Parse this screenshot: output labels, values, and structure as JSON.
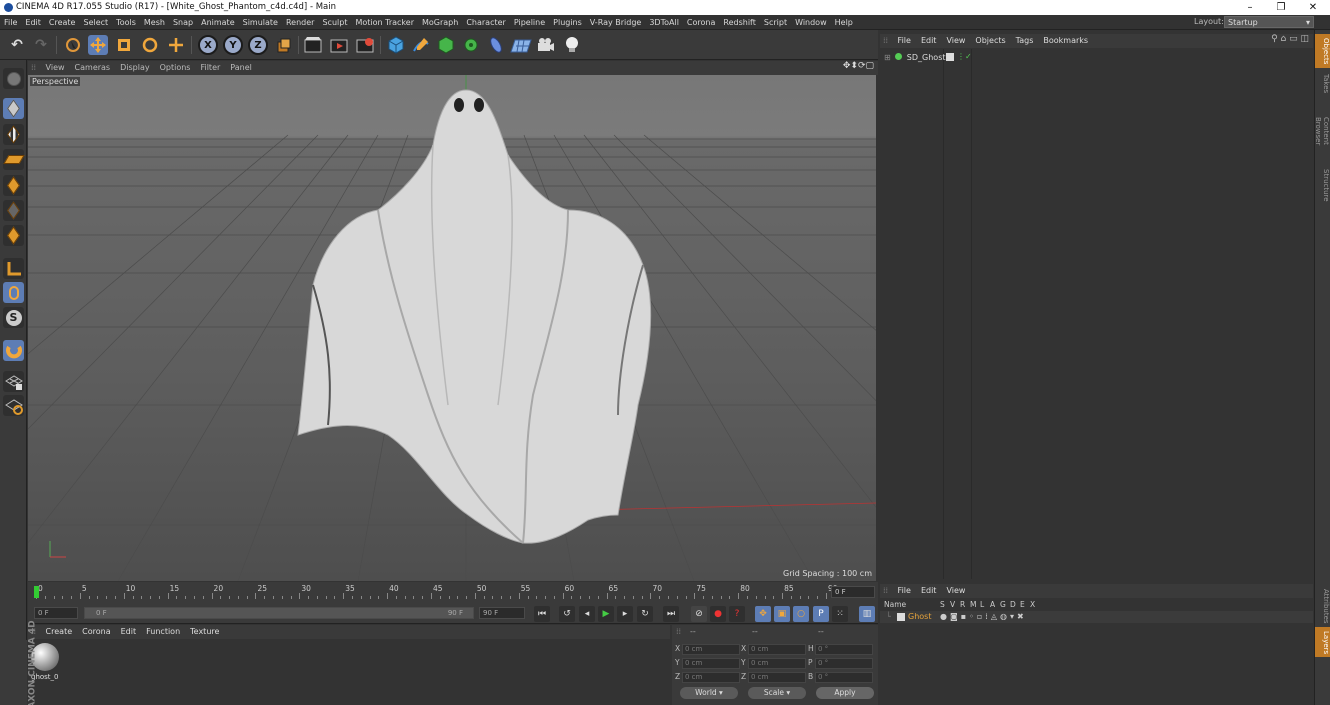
{
  "window": {
    "title": "CINEMA 4D R17.055 Studio (R17) - [White_Ghost_Phantom_c4d.c4d] - Main",
    "controls": [
      "–",
      "❐",
      "✕"
    ]
  },
  "menubar": {
    "items": [
      "File",
      "Edit",
      "Create",
      "Select",
      "Tools",
      "Mesh",
      "Snap",
      "Animate",
      "Simulate",
      "Render",
      "Sculpt",
      "Motion Tracker",
      "MoGraph",
      "Character",
      "Pipeline",
      "Plugins",
      "V-Ray Bridge",
      "3DToAll",
      "Corona",
      "Redshift",
      "Script",
      "Window",
      "Help"
    ],
    "layout_label": "Layout:",
    "layout_value": "Startup"
  },
  "toolbar": {
    "axis_x": "X",
    "axis_y": "Y",
    "axis_z": "Z"
  },
  "viewport": {
    "menu": [
      "View",
      "Cameras",
      "Display",
      "Options",
      "Filter",
      "Panel"
    ],
    "view_name": "Perspective",
    "grid_spacing": "Grid Spacing : 100 cm"
  },
  "timeline": {
    "ticks": [
      "0",
      "5",
      "10",
      "15",
      "20",
      "25",
      "30",
      "35",
      "40",
      "45",
      "50",
      "55",
      "60",
      "65",
      "70",
      "75",
      "80",
      "85",
      "90"
    ],
    "current_frame": "0 F",
    "start_field": "0 F",
    "range_start": "0 F",
    "range_end": "90 F",
    "end_field": "90 F"
  },
  "material_manager": {
    "menu": [
      "Create",
      "Corona",
      "Edit",
      "Function",
      "Texture"
    ],
    "materials": [
      {
        "name": "ghost_0"
      }
    ],
    "brand_text": "MAXON CINEMA 4D"
  },
  "coordinates": {
    "headers": [
      "--",
      "--",
      "--"
    ],
    "rows": [
      {
        "a": "X",
        "v1": "0 cm",
        "b": "X",
        "v2": "0 cm",
        "c": "H",
        "v3": "0 °"
      },
      {
        "a": "Y",
        "v1": "0 cm",
        "b": "Y",
        "v2": "0 cm",
        "c": "P",
        "v3": "0 °"
      },
      {
        "a": "Z",
        "v1": "0 cm",
        "b": "Z",
        "v2": "0 cm",
        "c": "B",
        "v3": "0 °"
      }
    ],
    "world_label": "World",
    "scale_label": "Scale",
    "apply_label": "Apply"
  },
  "object_manager": {
    "menu": [
      "File",
      "Edit",
      "View",
      "Objects",
      "Tags",
      "Bookmarks"
    ],
    "objects": [
      {
        "name": "SD_Ghost"
      }
    ]
  },
  "layer_manager": {
    "menu": [
      "File",
      "Edit",
      "View"
    ],
    "columns": [
      "Name",
      "S",
      "V",
      "R",
      "M",
      "L",
      "A",
      "G",
      "D",
      "E",
      "X"
    ],
    "layers": [
      {
        "name": "Ghost",
        "color": "#d9a24c"
      }
    ]
  },
  "right_tabs": [
    "Objects",
    "Takes",
    "Content Browser",
    "Structure",
    "Attributes",
    "Layers"
  ],
  "colors": {
    "accent_blue": "#5d7db5",
    "accent_orange": "#c07a25",
    "layer_name": "#e6a33b"
  }
}
